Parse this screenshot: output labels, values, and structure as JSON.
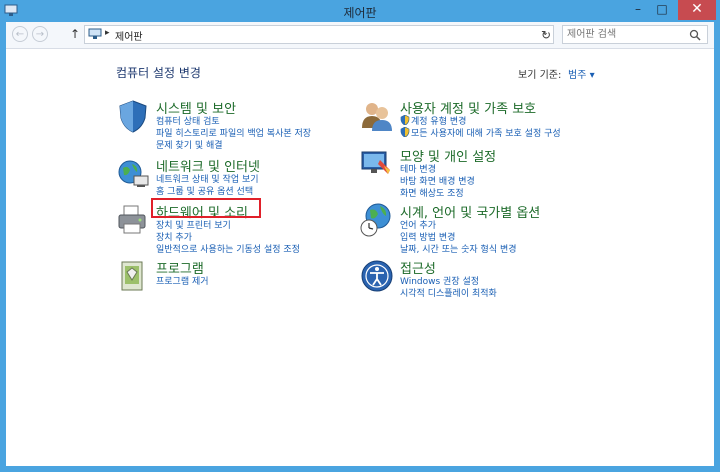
{
  "window": {
    "title": "제어판",
    "close_glyph": "✕",
    "minimize_glyph": "–",
    "maximize_glyph": "□"
  },
  "address_bar": {
    "path": "제어판",
    "breadcrumb_sep": "▸",
    "dropdown_glyph": "⌄",
    "back_glyph": "←",
    "forward_glyph": "→",
    "up_glyph": "↑",
    "refresh_glyph": "↻"
  },
  "search": {
    "placeholder": "제어판 검색"
  },
  "page": {
    "heading": "컴퓨터 설정 변경",
    "view_by_label": "보기 기준:",
    "view_by_value": "범주 ▾"
  },
  "categories": {
    "system": {
      "title": "시스템 및 보안",
      "links": [
        "컴퓨터 상태 검토",
        "파일 히스토리로 파일의 백업 복사본 저장",
        "문제 찾기 및 해결"
      ]
    },
    "network": {
      "title": "네트워크 및 인터넷",
      "links": [
        "네트워크 상태 및 작업 보기",
        "홈 그룹 및 공유 옵션 선택"
      ]
    },
    "hardware": {
      "title": "하드웨어 및 소리",
      "links": [
        "장치 및 프린터 보기",
        "장치 추가",
        "일반적으로 사용하는 기동성 설정 조정"
      ]
    },
    "programs": {
      "title": "프로그램",
      "links": [
        "프로그램 제거"
      ]
    },
    "user": {
      "title": "사용자 계정 및 가족 보호",
      "links": [
        "계정 유형 변경",
        "모든 사용자에 대해 가족 보호 설정 구성"
      ]
    },
    "appearance": {
      "title": "모양 및 개인 설정",
      "links": [
        "테마 변경",
        "바탕 화면 배경 변경",
        "화면 해상도 조정"
      ]
    },
    "clock": {
      "title": "시계, 언어 및 국가별 옵션",
      "links": [
        "언어 추가",
        "입력 방법 변경",
        "날짜, 시간 또는 숫자 형식 변경"
      ]
    },
    "ease": {
      "title": "접근성",
      "links": [
        "Windows 권장 설정",
        "시각적 디스플레이 최적화"
      ]
    }
  },
  "colors": {
    "title_bar": "#4aa4e0",
    "category_title": "#1d6b2a",
    "link": "#1a5fb4",
    "highlight": "#e0202a",
    "close": "#c74b50"
  }
}
